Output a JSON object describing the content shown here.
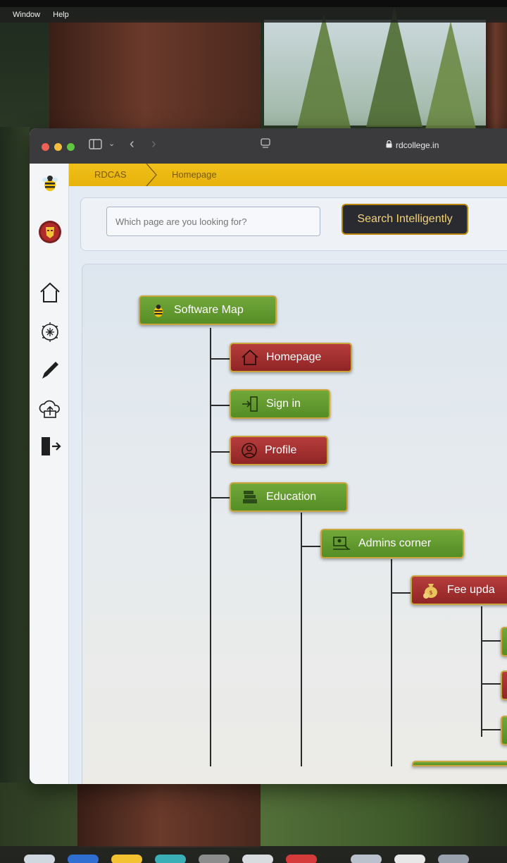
{
  "menubar": {
    "items": [
      "Window",
      "Help"
    ]
  },
  "browser": {
    "url": "rdcollege.in"
  },
  "breadcrumb": {
    "items": [
      "RDCAS",
      "Homepage"
    ]
  },
  "search": {
    "placeholder": "Which page are you looking for?",
    "button_label": "Search Intelligently"
  },
  "map": {
    "root": {
      "label": "Software Map",
      "color": "green"
    },
    "children": [
      {
        "label": "Homepage",
        "color": "red",
        "icon": "home-icon"
      },
      {
        "label": "Sign in",
        "color": "green",
        "icon": "sign-in-icon"
      },
      {
        "label": "Profile",
        "color": "red",
        "icon": "user-circle-icon"
      },
      {
        "label": "Education",
        "color": "green",
        "icon": "books-icon"
      }
    ],
    "education_children": [
      {
        "label": "Admins corner",
        "color": "green",
        "icon": "admin-desk-icon"
      }
    ],
    "admins_children": [
      {
        "label": "Fee upda",
        "color": "red",
        "icon": "money-bag-icon"
      }
    ]
  },
  "colors": {
    "node_green": "#5f9a2e",
    "node_red": "#a33131",
    "brand_yellow": "#f1c01a"
  },
  "rail_icons": [
    "bee-logo-icon",
    "avatar-icon",
    "home-icon",
    "ai-chip-icon",
    "pen-icon",
    "cloud-upload-icon",
    "logout-icon"
  ]
}
